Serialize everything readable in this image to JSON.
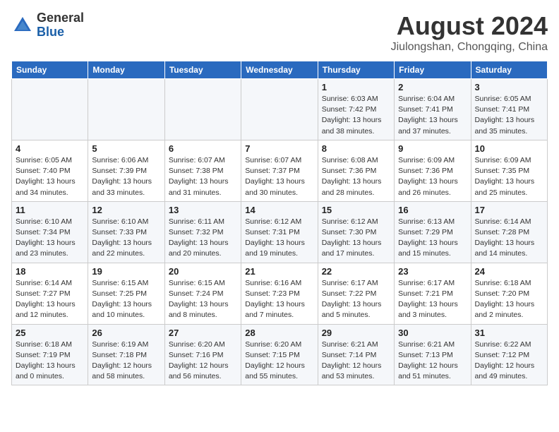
{
  "header": {
    "logo_general": "General",
    "logo_blue": "Blue",
    "month_title": "August 2024",
    "location": "Jiulongshan, Chongqing, China"
  },
  "days_of_week": [
    "Sunday",
    "Monday",
    "Tuesday",
    "Wednesday",
    "Thursday",
    "Friday",
    "Saturday"
  ],
  "weeks": [
    [
      {
        "day": "",
        "info": ""
      },
      {
        "day": "",
        "info": ""
      },
      {
        "day": "",
        "info": ""
      },
      {
        "day": "",
        "info": ""
      },
      {
        "day": "1",
        "info": "Sunrise: 6:03 AM\nSunset: 7:42 PM\nDaylight: 13 hours\nand 38 minutes."
      },
      {
        "day": "2",
        "info": "Sunrise: 6:04 AM\nSunset: 7:41 PM\nDaylight: 13 hours\nand 37 minutes."
      },
      {
        "day": "3",
        "info": "Sunrise: 6:05 AM\nSunset: 7:41 PM\nDaylight: 13 hours\nand 35 minutes."
      }
    ],
    [
      {
        "day": "4",
        "info": "Sunrise: 6:05 AM\nSunset: 7:40 PM\nDaylight: 13 hours\nand 34 minutes."
      },
      {
        "day": "5",
        "info": "Sunrise: 6:06 AM\nSunset: 7:39 PM\nDaylight: 13 hours\nand 33 minutes."
      },
      {
        "day": "6",
        "info": "Sunrise: 6:07 AM\nSunset: 7:38 PM\nDaylight: 13 hours\nand 31 minutes."
      },
      {
        "day": "7",
        "info": "Sunrise: 6:07 AM\nSunset: 7:37 PM\nDaylight: 13 hours\nand 30 minutes."
      },
      {
        "day": "8",
        "info": "Sunrise: 6:08 AM\nSunset: 7:36 PM\nDaylight: 13 hours\nand 28 minutes."
      },
      {
        "day": "9",
        "info": "Sunrise: 6:09 AM\nSunset: 7:36 PM\nDaylight: 13 hours\nand 26 minutes."
      },
      {
        "day": "10",
        "info": "Sunrise: 6:09 AM\nSunset: 7:35 PM\nDaylight: 13 hours\nand 25 minutes."
      }
    ],
    [
      {
        "day": "11",
        "info": "Sunrise: 6:10 AM\nSunset: 7:34 PM\nDaylight: 13 hours\nand 23 minutes."
      },
      {
        "day": "12",
        "info": "Sunrise: 6:10 AM\nSunset: 7:33 PM\nDaylight: 13 hours\nand 22 minutes."
      },
      {
        "day": "13",
        "info": "Sunrise: 6:11 AM\nSunset: 7:32 PM\nDaylight: 13 hours\nand 20 minutes."
      },
      {
        "day": "14",
        "info": "Sunrise: 6:12 AM\nSunset: 7:31 PM\nDaylight: 13 hours\nand 19 minutes."
      },
      {
        "day": "15",
        "info": "Sunrise: 6:12 AM\nSunset: 7:30 PM\nDaylight: 13 hours\nand 17 minutes."
      },
      {
        "day": "16",
        "info": "Sunrise: 6:13 AM\nSunset: 7:29 PM\nDaylight: 13 hours\nand 15 minutes."
      },
      {
        "day": "17",
        "info": "Sunrise: 6:14 AM\nSunset: 7:28 PM\nDaylight: 13 hours\nand 14 minutes."
      }
    ],
    [
      {
        "day": "18",
        "info": "Sunrise: 6:14 AM\nSunset: 7:27 PM\nDaylight: 13 hours\nand 12 minutes."
      },
      {
        "day": "19",
        "info": "Sunrise: 6:15 AM\nSunset: 7:25 PM\nDaylight: 13 hours\nand 10 minutes."
      },
      {
        "day": "20",
        "info": "Sunrise: 6:15 AM\nSunset: 7:24 PM\nDaylight: 13 hours\nand 8 minutes."
      },
      {
        "day": "21",
        "info": "Sunrise: 6:16 AM\nSunset: 7:23 PM\nDaylight: 13 hours\nand 7 minutes."
      },
      {
        "day": "22",
        "info": "Sunrise: 6:17 AM\nSunset: 7:22 PM\nDaylight: 13 hours\nand 5 minutes."
      },
      {
        "day": "23",
        "info": "Sunrise: 6:17 AM\nSunset: 7:21 PM\nDaylight: 13 hours\nand 3 minutes."
      },
      {
        "day": "24",
        "info": "Sunrise: 6:18 AM\nSunset: 7:20 PM\nDaylight: 13 hours\nand 2 minutes."
      }
    ],
    [
      {
        "day": "25",
        "info": "Sunrise: 6:18 AM\nSunset: 7:19 PM\nDaylight: 13 hours\nand 0 minutes."
      },
      {
        "day": "26",
        "info": "Sunrise: 6:19 AM\nSunset: 7:18 PM\nDaylight: 12 hours\nand 58 minutes."
      },
      {
        "day": "27",
        "info": "Sunrise: 6:20 AM\nSunset: 7:16 PM\nDaylight: 12 hours\nand 56 minutes."
      },
      {
        "day": "28",
        "info": "Sunrise: 6:20 AM\nSunset: 7:15 PM\nDaylight: 12 hours\nand 55 minutes."
      },
      {
        "day": "29",
        "info": "Sunrise: 6:21 AM\nSunset: 7:14 PM\nDaylight: 12 hours\nand 53 minutes."
      },
      {
        "day": "30",
        "info": "Sunrise: 6:21 AM\nSunset: 7:13 PM\nDaylight: 12 hours\nand 51 minutes."
      },
      {
        "day": "31",
        "info": "Sunrise: 6:22 AM\nSunset: 7:12 PM\nDaylight: 12 hours\nand 49 minutes."
      }
    ]
  ]
}
